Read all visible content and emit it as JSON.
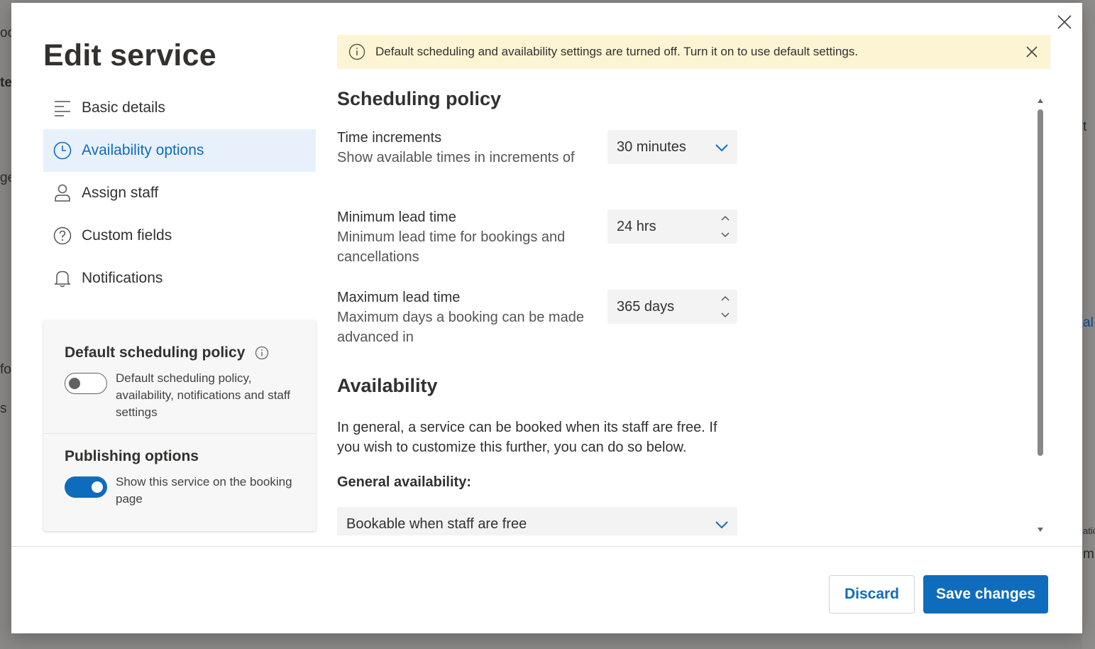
{
  "dialog": {
    "title": "Edit service"
  },
  "nav": {
    "items": [
      {
        "label": "Basic details",
        "icon": "lines-icon"
      },
      {
        "label": "Availability options",
        "icon": "clock-icon",
        "active": true
      },
      {
        "label": "Assign staff",
        "icon": "person-icon"
      },
      {
        "label": "Custom fields",
        "icon": "question-icon"
      },
      {
        "label": "Notifications",
        "icon": "bell-icon"
      }
    ]
  },
  "side_card": {
    "default_policy": {
      "heading": "Default scheduling policy",
      "toggle_text": "Default scheduling policy, availability, notifications and staff settings",
      "on": false
    },
    "publishing": {
      "heading": "Publishing options",
      "toggle_text": "Show this service on the booking page",
      "on": true
    }
  },
  "banner": {
    "text": "Default scheduling and availability settings are turned off. Turn it on to use default settings."
  },
  "scheduling": {
    "heading": "Scheduling policy",
    "time_increments": {
      "label": "Time increments",
      "desc": "Show available times in increments of",
      "value": "30 minutes"
    },
    "min_lead": {
      "label": "Minimum lead time",
      "desc": "Minimum lead time for bookings and cancellations",
      "value": "24 hrs"
    },
    "max_lead": {
      "label": "Maximum lead time",
      "desc": "Maximum days a booking can be made advanced in",
      "value": "365 days"
    }
  },
  "availability": {
    "heading": "Availability",
    "text": "In general, a service can be booked when its staff are free. If you wish to customize this further, you can do so below.",
    "general_label": "General availability:",
    "general_value": "Bookable when staff are free"
  },
  "footer": {
    "discard_label": "Discard",
    "save_label": "Save changes"
  },
  "background": {
    "fragments": [
      "oo",
      "te",
      "ge",
      "fo",
      "s",
      "t",
      "al",
      "atio",
      "mi"
    ]
  },
  "colors": {
    "accent": "#0f6cbd",
    "banner_bg": "#fcf4d3",
    "active_nav_bg": "#e8f1fb"
  }
}
